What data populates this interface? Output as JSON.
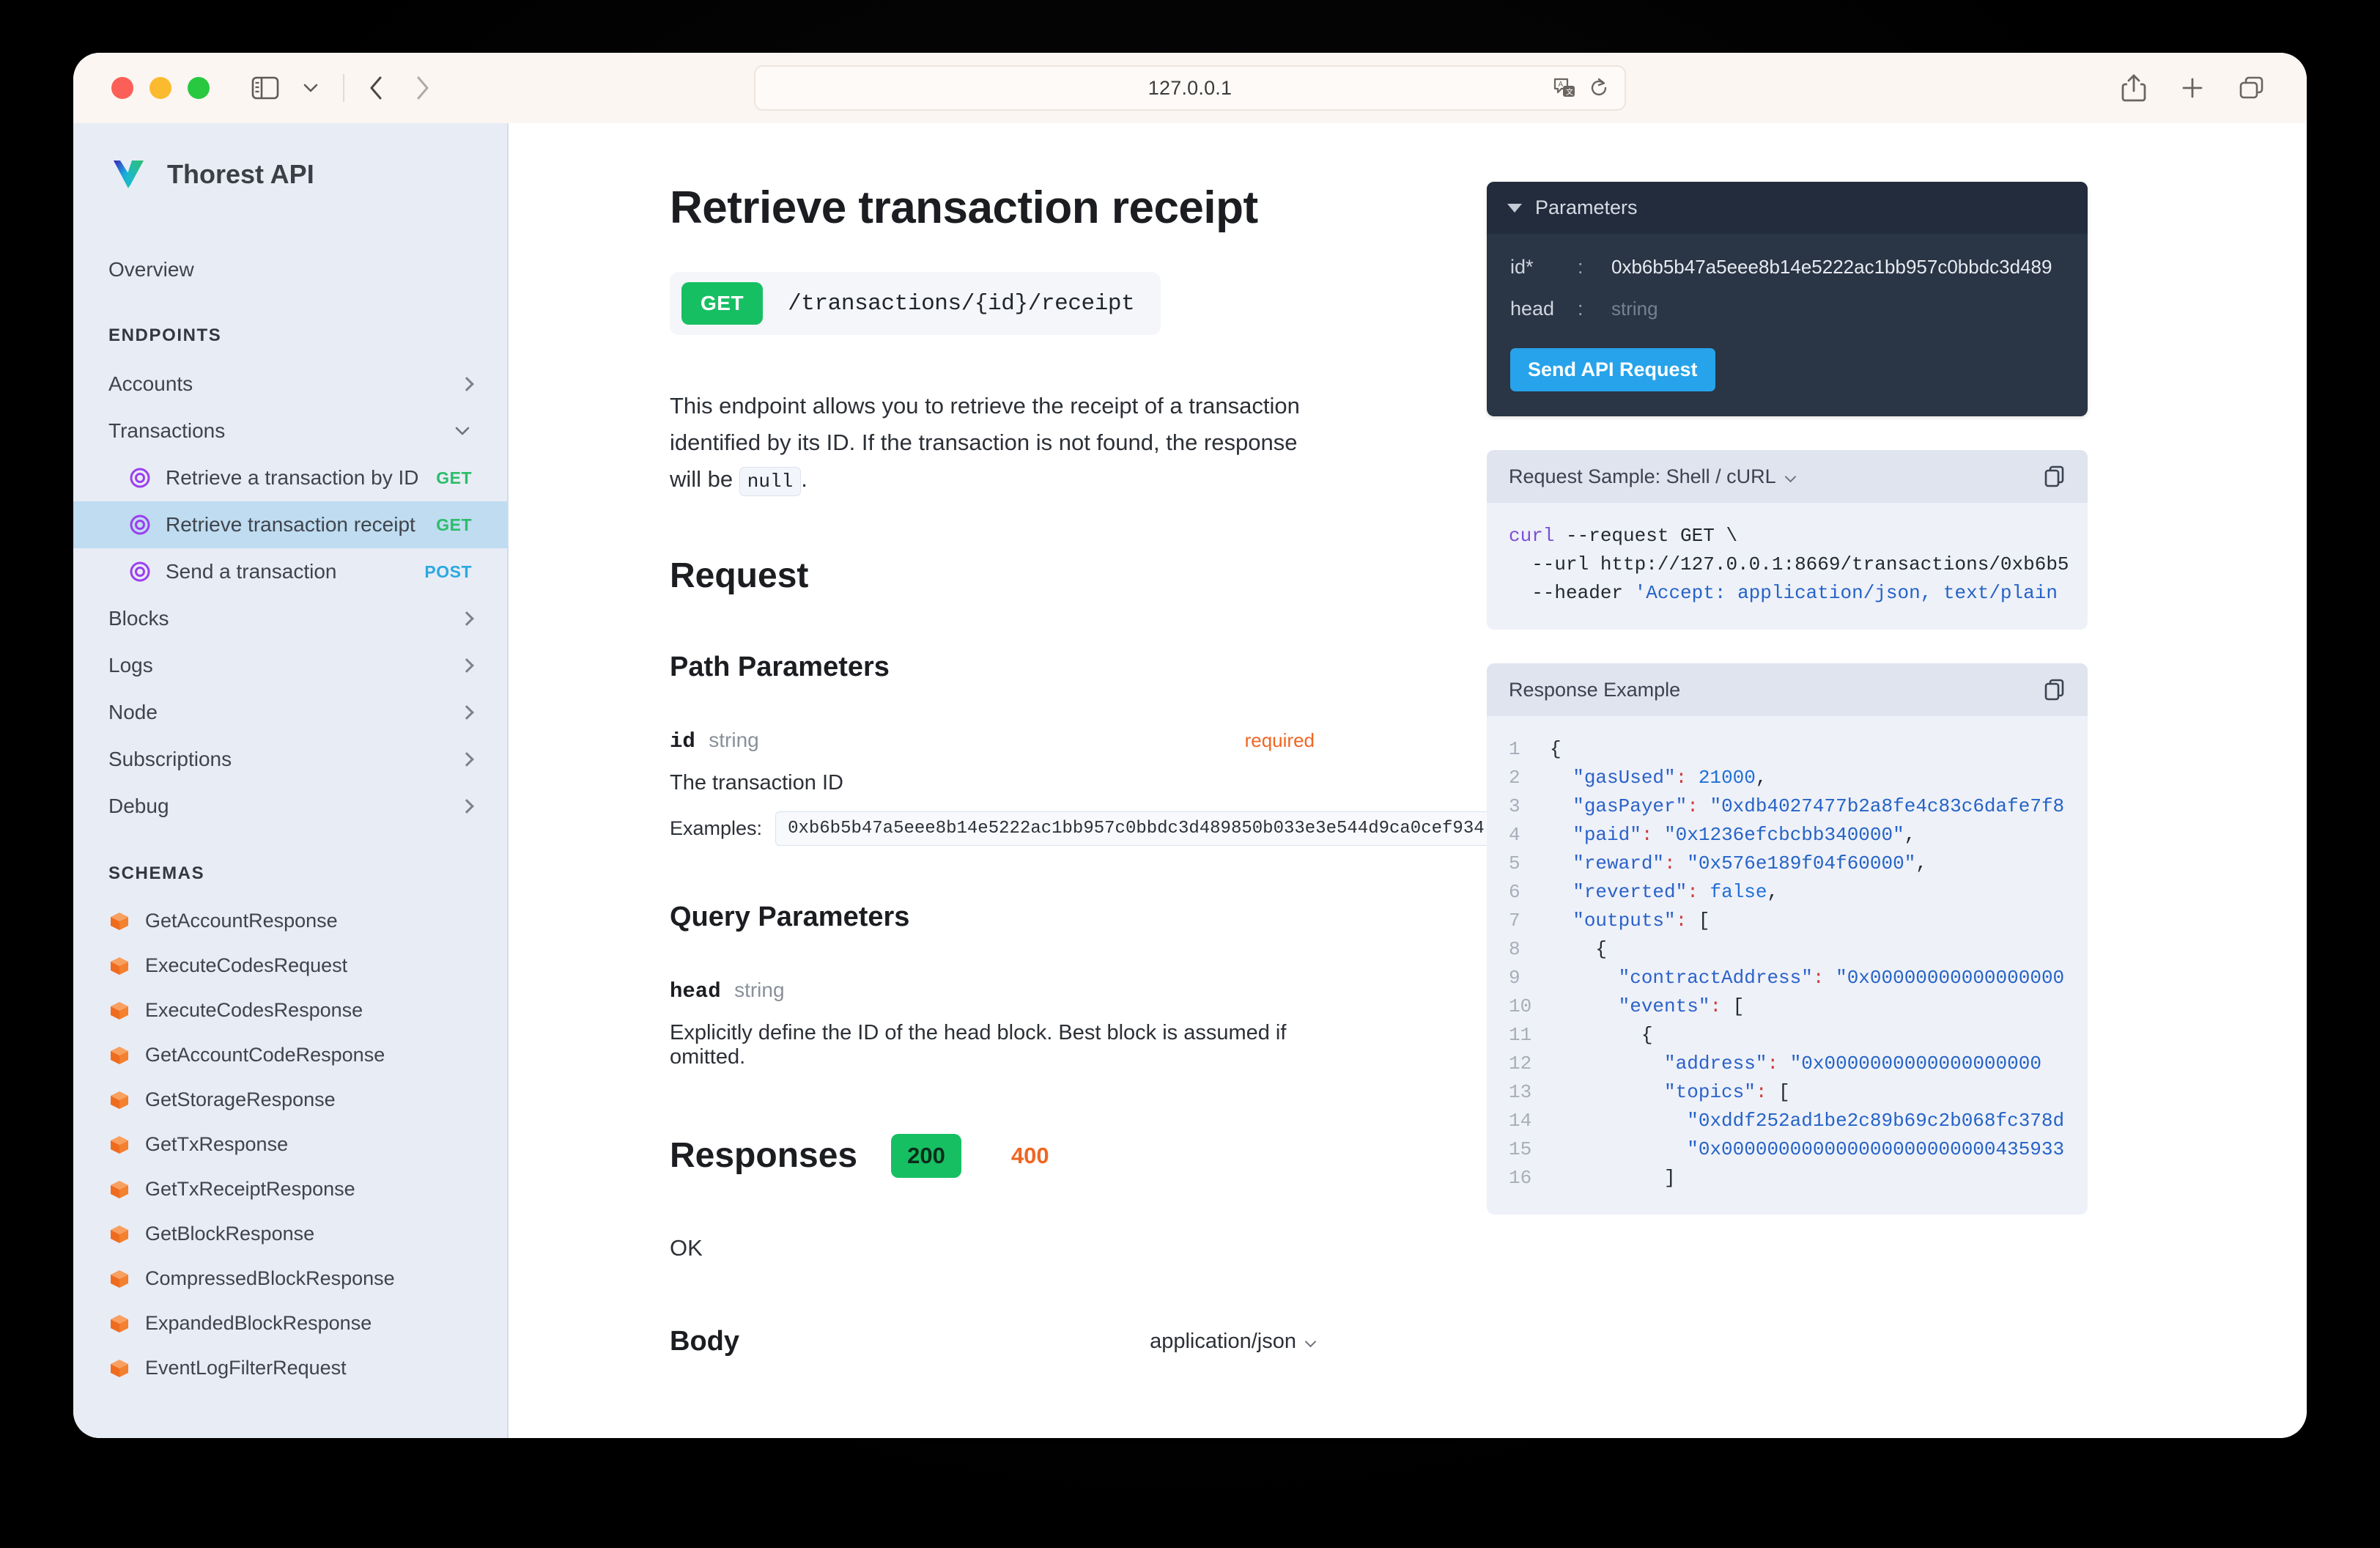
{
  "browser": {
    "url": "127.0.0.1",
    "icons": {
      "sidebar_toggle": "sidebar-toggle-icon",
      "tab_dropdown": "chevron-down-icon",
      "back": "back-chevron-icon",
      "forward": "forward-chevron-icon",
      "translate": "translate-icon",
      "reload": "reload-icon",
      "share": "share-icon",
      "new_tab": "plus-icon",
      "tab_overview": "tab-overview-icon"
    }
  },
  "sidebar": {
    "brand": "Thorest API",
    "overview": "Overview",
    "endpoints_label": "ENDPOINTS",
    "schemas_label": "SCHEMAS",
    "groups": [
      {
        "label": "Accounts",
        "expanded": false
      },
      {
        "label": "Transactions",
        "expanded": true,
        "items": [
          {
            "label": "Retrieve a transaction by ID",
            "method": "GET",
            "active": false
          },
          {
            "label": "Retrieve transaction receipt",
            "method": "GET",
            "active": true
          },
          {
            "label": "Send a transaction",
            "method": "POST",
            "active": false
          }
        ]
      },
      {
        "label": "Blocks",
        "expanded": false
      },
      {
        "label": "Logs",
        "expanded": false
      },
      {
        "label": "Node",
        "expanded": false
      },
      {
        "label": "Subscriptions",
        "expanded": false
      },
      {
        "label": "Debug",
        "expanded": false
      }
    ],
    "schemas": [
      "GetAccountResponse",
      "ExecuteCodesRequest",
      "ExecuteCodesResponse",
      "GetAccountCodeResponse",
      "GetStorageResponse",
      "GetTxResponse",
      "GetTxReceiptResponse",
      "GetBlockResponse",
      "CompressedBlockResponse",
      "ExpandedBlockResponse",
      "EventLogFilterRequest"
    ]
  },
  "doc": {
    "title": "Retrieve transaction receipt",
    "method_badge": "GET",
    "path": "/transactions/{id}/receipt",
    "description_1": "This endpoint allows you to retrieve the receipt of a transaction identified",
    "description_2": "by its ID. If the transaction is not found, the response will be",
    "description_code": "null",
    "description_end": ".",
    "request_heading": "Request",
    "path_params_heading": "Path Parameters",
    "path_param": {
      "name": "id",
      "type": "string",
      "required_label": "required",
      "description": "The transaction ID",
      "examples_label": "Examples:",
      "example_value": "0xb6b5b47a5eee8b14e5222ac1bb957c0bbdc3d489850b033e3e544d9ca0cef934"
    },
    "query_params_heading": "Query Parameters",
    "query_param": {
      "name": "head",
      "type": "string",
      "description": "Explicitly define the ID of the head block. Best block is assumed if omitted."
    },
    "responses_heading": "Responses",
    "status_tabs": [
      {
        "code": "200",
        "selected": true
      },
      {
        "code": "400",
        "selected": false
      }
    ],
    "ok_text": "OK",
    "body_heading": "Body",
    "content_type": "application/json"
  },
  "parameters_panel": {
    "title": "Parameters",
    "rows": [
      {
        "key": "id*",
        "colon": ":",
        "value": "0xb6b5b47a5eee8b14e5222ac1bb957c0bbdc3d489",
        "placeholder": false
      },
      {
        "key": "head",
        "colon": ":",
        "value": "string",
        "placeholder": true
      }
    ],
    "send_label": "Send API Request"
  },
  "request_sample": {
    "title": "Request Sample: Shell / cURL",
    "copy_icon": "copy-icon",
    "lines": [
      {
        "parts": [
          {
            "t": "curl",
            "c": "cmd"
          },
          {
            "t": " --request GET \\",
            "c": ""
          }
        ]
      },
      {
        "parts": [
          {
            "t": "  --url http://127.0.0.1:8669/transactions/0xb6b5",
            "c": ""
          }
        ]
      },
      {
        "parts": [
          {
            "t": "  --header ",
            "c": ""
          },
          {
            "t": "'Accept: application/json, text/plain",
            "c": "str"
          }
        ]
      }
    ]
  },
  "response_example": {
    "title": "Response Example",
    "copy_icon": "copy-icon",
    "lines": [
      {
        "n": "1",
        "parts": [
          {
            "t": "{",
            "c": ""
          }
        ]
      },
      {
        "n": "2",
        "parts": [
          {
            "t": "  ",
            "c": ""
          },
          {
            "t": "\"gasUsed\"",
            "c": "key"
          },
          {
            "t": ":",
            "c": "punc"
          },
          {
            "t": " ",
            "c": ""
          },
          {
            "t": "21000",
            "c": "num"
          },
          {
            "t": ",",
            "c": ""
          }
        ]
      },
      {
        "n": "3",
        "parts": [
          {
            "t": "  ",
            "c": ""
          },
          {
            "t": "\"gasPayer\"",
            "c": "key"
          },
          {
            "t": ":",
            "c": "punc"
          },
          {
            "t": " ",
            "c": ""
          },
          {
            "t": "\"0xdb4027477b2a8fe4c83c6dafe7f8",
            "c": "str"
          }
        ]
      },
      {
        "n": "4",
        "parts": [
          {
            "t": "  ",
            "c": ""
          },
          {
            "t": "\"paid\"",
            "c": "key"
          },
          {
            "t": ":",
            "c": "punc"
          },
          {
            "t": " ",
            "c": ""
          },
          {
            "t": "\"0x1236efcbcbb340000\"",
            "c": "str"
          },
          {
            "t": ",",
            "c": ""
          }
        ]
      },
      {
        "n": "5",
        "parts": [
          {
            "t": "  ",
            "c": ""
          },
          {
            "t": "\"reward\"",
            "c": "key"
          },
          {
            "t": ":",
            "c": "punc"
          },
          {
            "t": " ",
            "c": ""
          },
          {
            "t": "\"0x576e189f04f60000\"",
            "c": "str"
          },
          {
            "t": ",",
            "c": ""
          }
        ]
      },
      {
        "n": "6",
        "parts": [
          {
            "t": "  ",
            "c": ""
          },
          {
            "t": "\"reverted\"",
            "c": "key"
          },
          {
            "t": ":",
            "c": "punc"
          },
          {
            "t": " ",
            "c": ""
          },
          {
            "t": "false",
            "c": "bool"
          },
          {
            "t": ",",
            "c": ""
          }
        ]
      },
      {
        "n": "7",
        "parts": [
          {
            "t": "  ",
            "c": ""
          },
          {
            "t": "\"outputs\"",
            "c": "key"
          },
          {
            "t": ":",
            "c": "punc"
          },
          {
            "t": " [",
            "c": ""
          }
        ]
      },
      {
        "n": "8",
        "parts": [
          {
            "t": "    {",
            "c": ""
          }
        ]
      },
      {
        "n": "9",
        "parts": [
          {
            "t": "      ",
            "c": ""
          },
          {
            "t": "\"contractAddress\"",
            "c": "key"
          },
          {
            "t": ":",
            "c": "punc"
          },
          {
            "t": " ",
            "c": ""
          },
          {
            "t": "\"0x00000000000000000",
            "c": "str"
          }
        ]
      },
      {
        "n": "10",
        "parts": [
          {
            "t": "      ",
            "c": ""
          },
          {
            "t": "\"events\"",
            "c": "key"
          },
          {
            "t": ":",
            "c": "punc"
          },
          {
            "t": " [",
            "c": ""
          }
        ]
      },
      {
        "n": "11",
        "parts": [
          {
            "t": "        {",
            "c": ""
          }
        ]
      },
      {
        "n": "12",
        "parts": [
          {
            "t": "          ",
            "c": ""
          },
          {
            "t": "\"address\"",
            "c": "key"
          },
          {
            "t": ":",
            "c": "punc"
          },
          {
            "t": " ",
            "c": ""
          },
          {
            "t": "\"0x0000000000000000000",
            "c": "str"
          }
        ]
      },
      {
        "n": "13",
        "parts": [
          {
            "t": "          ",
            "c": ""
          },
          {
            "t": "\"topics\"",
            "c": "key"
          },
          {
            "t": ":",
            "c": "punc"
          },
          {
            "t": " [",
            "c": ""
          }
        ]
      },
      {
        "n": "14",
        "parts": [
          {
            "t": "            ",
            "c": ""
          },
          {
            "t": "\"0xddf252ad1be2c89b69c2b068fc378d",
            "c": "str"
          }
        ]
      },
      {
        "n": "15",
        "parts": [
          {
            "t": "            ",
            "c": ""
          },
          {
            "t": "\"0x000000000000000000000000435933",
            "c": "str"
          }
        ]
      },
      {
        "n": "16",
        "parts": [
          {
            "t": "          ]",
            "c": ""
          }
        ]
      }
    ]
  },
  "colors": {
    "sidebar_bg": "#e8ecf5",
    "active_item": "#bfdcf0",
    "get_green": "#2bbd6a",
    "post_blue": "#2aa9e0",
    "badge_green": "#17bf63",
    "required_orange": "#f06623",
    "panel_dark": "#2a3545",
    "panel_header": "#222c3c",
    "send_blue": "#26a3ea",
    "schema_orange": "#f36f21",
    "endpoint_purple": "#9b3ff0"
  }
}
